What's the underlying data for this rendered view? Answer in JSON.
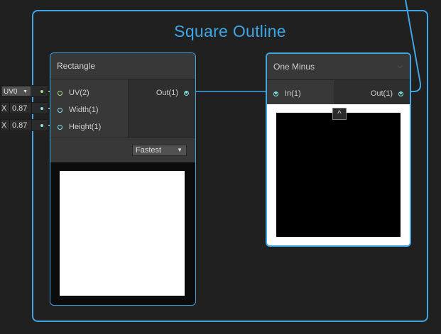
{
  "group": {
    "title": "Square Outline"
  },
  "rectangle_node": {
    "title": "Rectangle",
    "inputs": [
      {
        "label": "UV(2)"
      },
      {
        "label": "Width(1)"
      },
      {
        "label": "Height(1)"
      }
    ],
    "output": {
      "label": "Out(1)"
    },
    "mode_dropdown": {
      "value": "Fastest"
    },
    "preview_color": "#ffffff"
  },
  "one_minus_node": {
    "title": "One Minus",
    "input": {
      "label": "In(1)"
    },
    "output": {
      "label": "Out(1)"
    },
    "preview_color": "#000000"
  },
  "inline_inputs": {
    "uv": {
      "value": "UV0"
    },
    "width": {
      "label": "X",
      "value": "0.87"
    },
    "height": {
      "label": "X",
      "value": "0.87"
    }
  },
  "colors": {
    "accent": "#3ea6e6",
    "wire": "#84e4e7",
    "uv_wire": "#9fe07a",
    "background": "#202020"
  }
}
